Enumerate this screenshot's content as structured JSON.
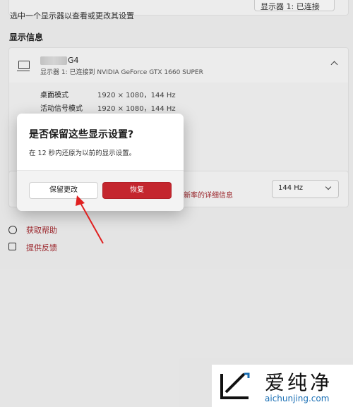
{
  "top_row": {
    "label": "选中一个显示器以查看或更改其设置",
    "dropdown_value": "显示器 1: 已连接"
  },
  "display_info": {
    "section_title": "显示信息",
    "monitor_name_suffix": "G4",
    "monitor_subtitle": "显示器 1: 已连接到 NVIDIA GeForce GTX 1660 SUPER",
    "details": [
      {
        "label": "桌面模式",
        "value": "1920 × 1080，144 Hz"
      },
      {
        "label": "活动信号模式",
        "value": "1920 × 1080，144 Hz"
      }
    ]
  },
  "refresh": {
    "link_text": "新率的详细信息",
    "dropdown_value": "144 Hz"
  },
  "links": {
    "help": "获取帮助",
    "feedback": "提供反馈"
  },
  "dialog": {
    "title": "是否保留这些显示设置?",
    "message": "在 12 秒内还原为以前的显示设置。",
    "keep_label": "保留更改",
    "revert_label": "恢复"
  },
  "watermark": {
    "brand": "爱纯净",
    "url": "aichunjing.com"
  },
  "colors": {
    "accent": "#c4262e",
    "link": "#a4262c",
    "url": "#1a6fb5"
  },
  "icons": [
    "monitor-icon",
    "chevron-up-icon",
    "chevron-down-icon",
    "help-icon",
    "feedback-icon",
    "arrow-annotation-icon"
  ]
}
